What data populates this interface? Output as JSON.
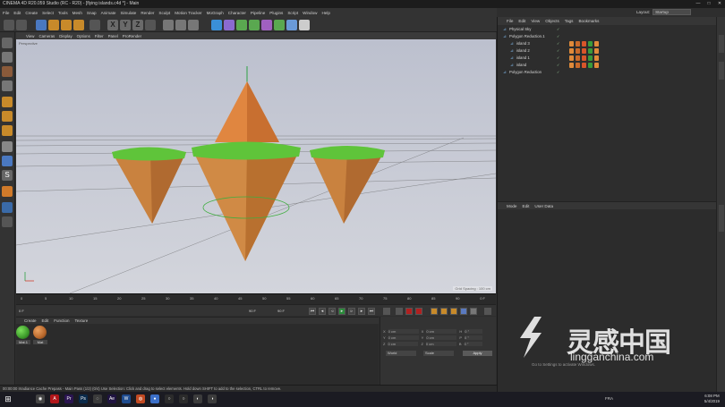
{
  "window": {
    "title": "CINEMA 4D R20.059 Studio (RC - R20) - [flying islands.c4d *] - Main",
    "controls": [
      "—",
      "□",
      "✕"
    ]
  },
  "menubar": [
    "File",
    "Edit",
    "Create",
    "Select",
    "Tools",
    "Mesh",
    "Snap",
    "Animate",
    "Simulate",
    "Render",
    "Sculpt",
    "Motion Tracker",
    "MoGraph",
    "Character",
    "Pipeline",
    "Plugins",
    "Script",
    "Window",
    "Help"
  ],
  "layout": {
    "label": "Layout:",
    "value": "Startup"
  },
  "viewport": {
    "menu": [
      "View",
      "Cameras",
      "Display",
      "Options",
      "Filter",
      "Panel",
      "ProRender"
    ],
    "label": "Perspective",
    "grid_spacing": "Grid Spacing : 100 cm"
  },
  "timeline": {
    "ticks": [
      "0",
      "5",
      "10",
      "15",
      "20",
      "25",
      "30",
      "35",
      "40",
      "45",
      "50",
      "55",
      "60",
      "65",
      "70",
      "75",
      "80",
      "85",
      "90"
    ],
    "frame": "0 F",
    "start": "0 F",
    "end": "90 F",
    "end2": "90 F"
  },
  "materials": {
    "menu": [
      "Create",
      "Edit",
      "Function",
      "Texture"
    ],
    "items": [
      {
        "name": "Mat.1",
        "color": "#4caf3a"
      },
      {
        "name": "Mat",
        "color": "#c9783a"
      }
    ]
  },
  "coords": {
    "rows": [
      {
        "a": "X",
        "av": "0 cm",
        "b": "X",
        "bv": "0 cm",
        "c": "H",
        "cv": "0 °"
      },
      {
        "a": "Y",
        "av": "0 cm",
        "b": "Y",
        "bv": "0 cm",
        "c": "P",
        "cv": "0 °"
      },
      {
        "a": "Z",
        "av": "0 cm",
        "b": "Z",
        "bv": "0 cm",
        "c": "B",
        "cv": "0 °"
      }
    ],
    "dropdown1": "World",
    "dropdown2": "Scale",
    "apply": "Apply"
  },
  "status": "00:00:00 Irradiance Cache Prepass - Main Pass (1/2) (0/4)     Use Selection: Click and drag to select elements. Hold down SHIFT to add to the selection, CTRL to remove.",
  "objects": {
    "menu": [
      "File",
      "Edit",
      "View",
      "Objects",
      "Tags",
      "Bookmarks"
    ],
    "rows": [
      {
        "name": "Physical Sky",
        "indent": 6
      },
      {
        "name": "Polygon Reduction.1",
        "indent": 6
      },
      {
        "name": "island 3",
        "indent": 14
      },
      {
        "name": "island 2",
        "indent": 14
      },
      {
        "name": "island 1",
        "indent": 14
      },
      {
        "name": "island",
        "indent": 14
      },
      {
        "name": "Polygon Reduction",
        "indent": 6
      }
    ]
  },
  "attributes": {
    "menu": [
      "Mode",
      "Edit",
      "User Data"
    ]
  },
  "taskbar": {
    "apps": [
      {
        "label": "◉",
        "color": "#444"
      },
      {
        "label": "A",
        "color": "#b2161a"
      },
      {
        "label": "Pr",
        "color": "#2a1450"
      },
      {
        "label": "Ps",
        "color": "#0b2a4a"
      },
      {
        "label": "◌",
        "color": "#3a3a3a"
      },
      {
        "label": "Ae",
        "color": "#1f1340"
      },
      {
        "label": "W",
        "color": "#1e4b8e"
      },
      {
        "label": "◍",
        "color": "#c24a22"
      },
      {
        "label": "●",
        "color": "#3b6fc8"
      },
      {
        "label": "○",
        "color": "#2b2b2b"
      },
      {
        "label": "○",
        "color": "#2b2b2b"
      },
      {
        "label": "◐",
        "color": "#3c3c3c"
      },
      {
        "label": "◑",
        "color": "#3c3c3c"
      }
    ],
    "lang": "FRA",
    "time": "6:08 PM",
    "date": "5/4/2019"
  },
  "watermark": {
    "text": "灵感中国",
    "url": "lingganchina.com",
    "activate": "Go to Settings to activate Windows."
  }
}
